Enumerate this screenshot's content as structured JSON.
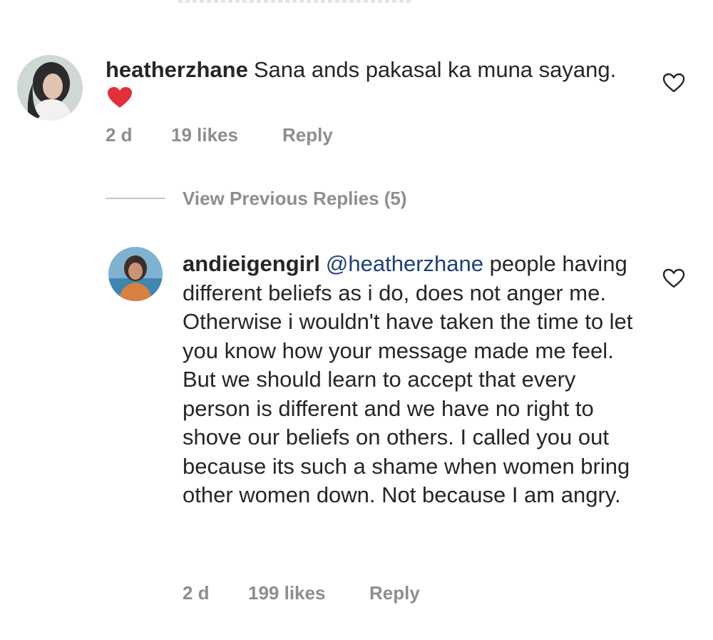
{
  "comments": [
    {
      "username": "heatherzhane",
      "text": "Sana ands pakasal ka muna sayang.",
      "emoji": "red-heart",
      "age": "2 d",
      "likes": "19 likes",
      "reply_label": "Reply"
    },
    {
      "username": "andieigengirl",
      "mention": "@heatherzhane",
      "text": "people having different beliefs as i do, does not anger me. Otherwise i wouldn't have taken the time to let you know how your message made me feel. But we should learn to accept that every person is different and we have no right to shove our beliefs on others. I called you out because its such a shame when women bring other women down. Not because I am angry.",
      "age": "2 d",
      "likes": "199 likes",
      "reply_label": "Reply"
    }
  ],
  "view_previous_replies": "View Previous Replies (5)",
  "colors": {
    "text": "#262626",
    "meta": "#8e8e8e",
    "mention": "#1f3f77",
    "heart": "#e0303a"
  }
}
